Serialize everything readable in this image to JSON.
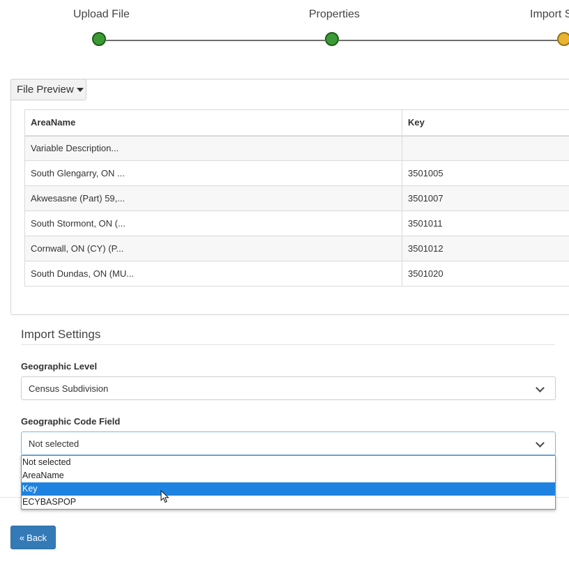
{
  "stepper": {
    "steps": [
      {
        "label": "Upload File",
        "state": "done"
      },
      {
        "label": "Properties",
        "state": "done"
      },
      {
        "label": "Import S",
        "state": "current"
      }
    ]
  },
  "file_preview": {
    "toggle_label": "File Preview",
    "columns": [
      "AreaName",
      "Key"
    ],
    "rows": [
      [
        "Variable Description...",
        ""
      ],
      [
        "South Glengarry, ON ...",
        "3501005"
      ],
      [
        "Akwesasne (Part) 59,...",
        "3501007"
      ],
      [
        "South Stormont, ON (...",
        "3501011"
      ],
      [
        "Cornwall, ON (CY) (P...",
        "3501012"
      ],
      [
        "South Dundas, ON (MU...",
        "3501020"
      ]
    ]
  },
  "import_settings": {
    "title": "Import Settings",
    "geographic_level": {
      "label": "Geographic Level",
      "value": "Census Subdivision"
    },
    "geographic_code_field": {
      "label": "Geographic Code Field",
      "value": "Not selected",
      "options": [
        "Not selected",
        "AreaName",
        "Key",
        "ECYBASPOP"
      ],
      "highlighted_option": "Key"
    }
  },
  "footer": {
    "back_label": "Back"
  },
  "colors": {
    "step_done": "#3c9a35",
    "step_current": "#e8b331",
    "primary_button": "#337ab7",
    "option_highlight": "#1e83e0"
  },
  "icons": {
    "toggle_caret": "caret-down-icon",
    "select_chevron": "chevron-down-icon",
    "back": "double-chevron-left-icon",
    "pointer": "mouse-pointer-icon"
  }
}
